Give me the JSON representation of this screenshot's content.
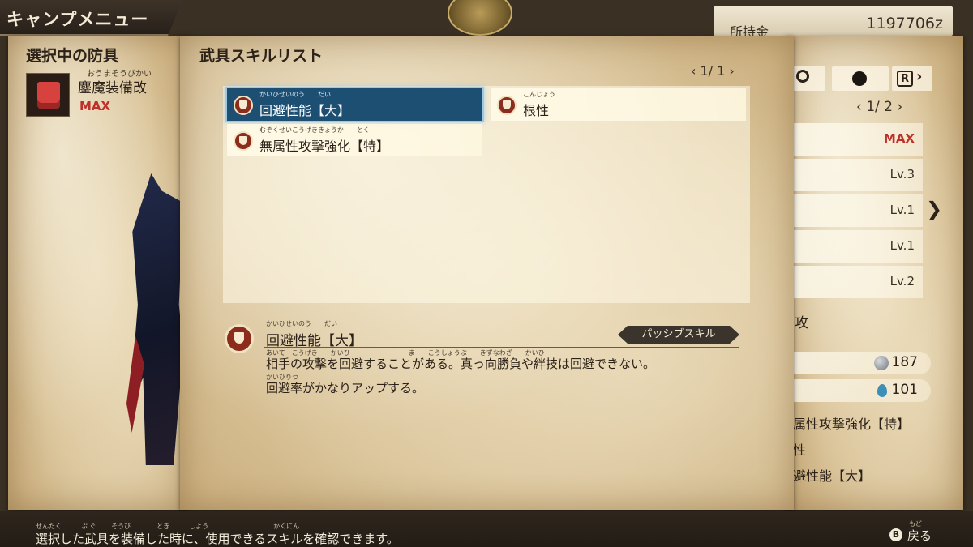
{
  "header": {
    "title": "キャンプメニュー"
  },
  "money": {
    "label": "所持金",
    "value": "1197706z"
  },
  "left_panel": {
    "title": "選択中の防具",
    "equip_ruby": "おうまそうびかい",
    "equip_name": "鏖魔装備改",
    "equip_level": "MAX"
  },
  "modal": {
    "title": "武具スキルリスト",
    "pager": "‹ 1/ 1 ›",
    "skills": [
      {
        "ruby": "かいひせいのう　　だい",
        "name": "回避性能【大】"
      },
      {
        "ruby": "こんじょう",
        "name": "根性"
      },
      {
        "ruby": "むぞくせいこうげききょうか　　とく",
        "name": "無属性攻撃強化【特】"
      }
    ],
    "detail": {
      "ruby": "かいひせいのう　　だい",
      "name": "回避性能【大】",
      "badge": "パッシブスキル",
      "desc_ruby_1": "あいて　こうげき　　かいひ　　　　　　　　　ま　　こうしょうぶ　　きずなわざ　　かいひ",
      "desc_line_1": "相手の攻撃を回避することがある。真っ向勝負や絆技は回避できない。",
      "desc_ruby_2": "かいひりつ",
      "desc_line_2": "回避率がかなりアップする。"
    }
  },
  "right_panel": {
    "pager": "‹ 1/ 2 ›",
    "r_button": "R",
    "levels": [
      "MAX",
      "Lv.3",
      "Lv.1",
      "Lv.1",
      "Lv.2"
    ],
    "partial_label": "攻",
    "stats": [
      {
        "icon": "silver-orb-icon",
        "value": "187"
      },
      {
        "icon": "water-drop-icon",
        "value": "101"
      }
    ],
    "skills": [
      "属性攻撃強化【特】",
      "性",
      "避性能【大】"
    ]
  },
  "footer": {
    "help_ruby": "せんたく　　　ぶ ぐ　　 そうび　　　　とき　　　しよう　　　　　　　　　　かくにん",
    "help_text": "選択した武具を装備した時に、使用できるスキルを確認できます。",
    "back_button_glyph": "B",
    "back_ruby": "もど",
    "back_label": "戻る"
  },
  "colors": {
    "selection": "#1d4f72",
    "max_red": "#c0302a",
    "skill_icon_red": "#8b2c1d"
  }
}
